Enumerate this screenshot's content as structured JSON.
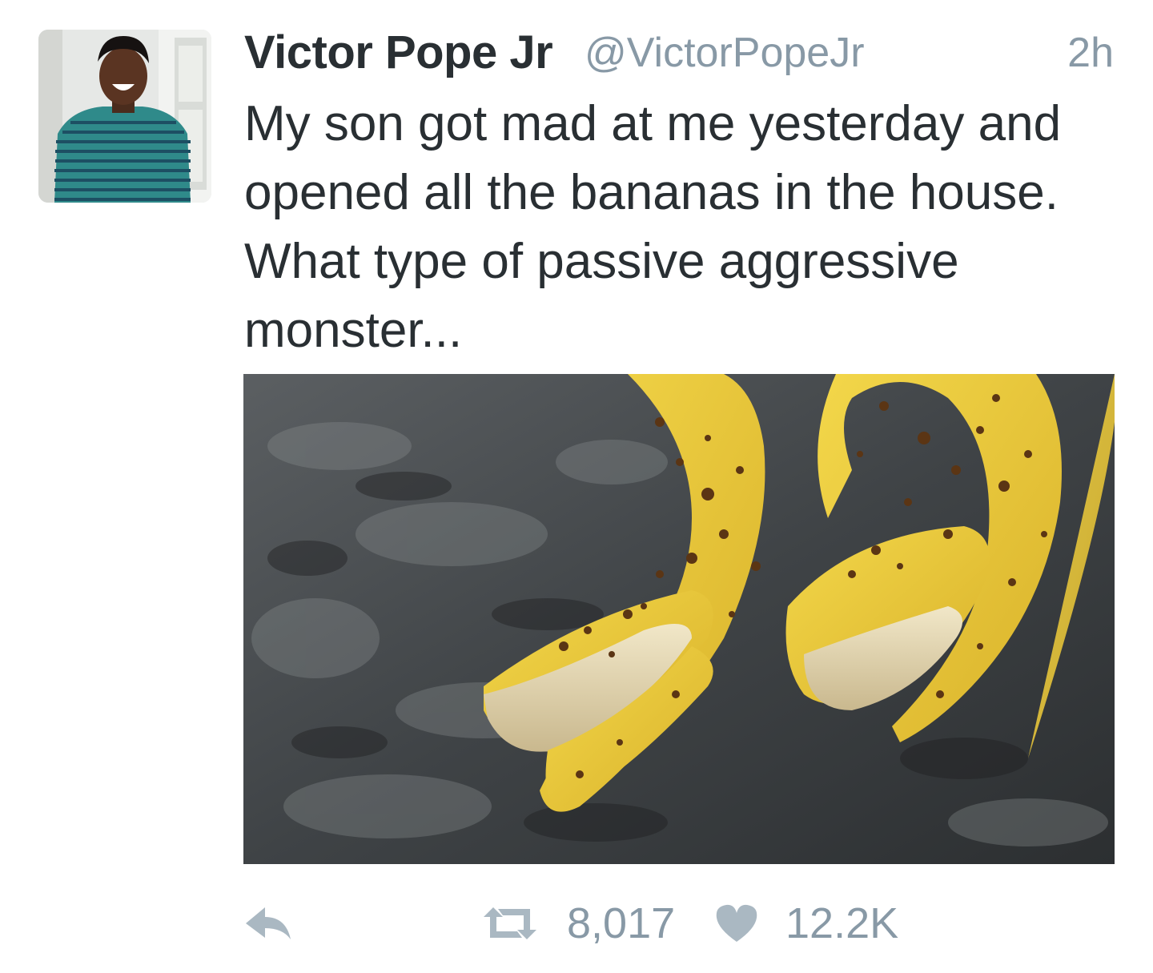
{
  "tweet": {
    "display_name": "Victor Pope Jr",
    "handle": "@VictorPopeJr",
    "time": "2h",
    "text": "My son got mad at me yesterday and\nopened all the bananas in the house.\nWhat type of passive aggressive\nmonster...",
    "avatar_icon": "profile-photo",
    "media_description_icon": "photo"
  },
  "actions": {
    "reply_icon": "reply-icon",
    "retweet_icon": "retweet-icon",
    "retweet_count": "8,017",
    "like_icon": "heart-icon",
    "like_count": "12.2K"
  },
  "colors": {
    "text": "#292f33",
    "secondary": "#8899a6",
    "action_icon": "#aab8c2"
  }
}
